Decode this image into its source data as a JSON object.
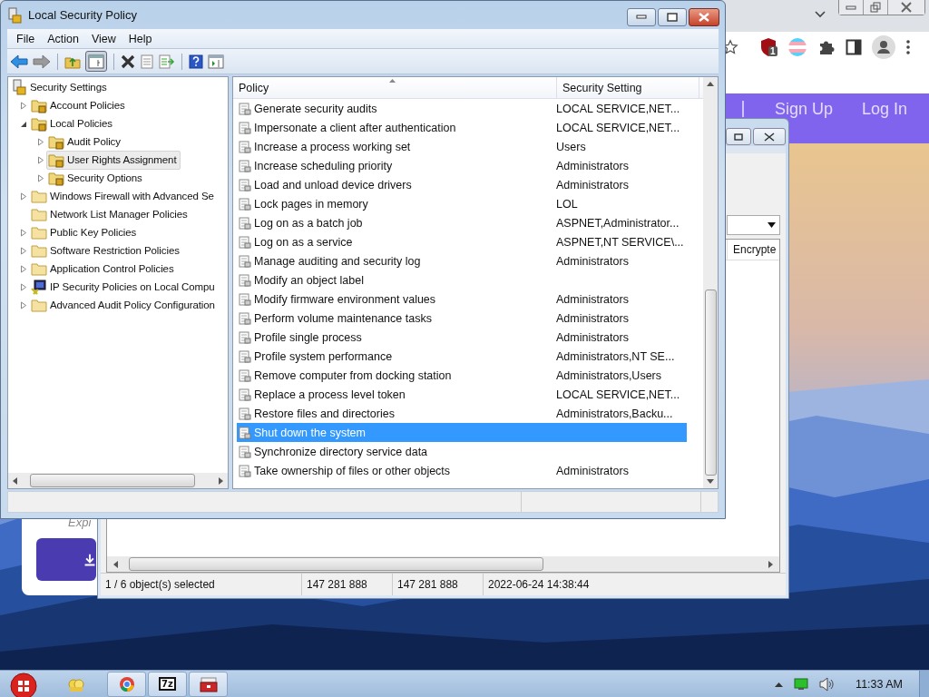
{
  "browser": {
    "extension_badge": "1",
    "nav": [
      "Sign Up",
      "Log In"
    ],
    "card_text": "Expi"
  },
  "zip_window": {
    "column_3": "Encrypte",
    "status": [
      "1 / 6 object(s) selected",
      "147 281 888",
      "147 281 888",
      "2022-06-24 14:38:44"
    ]
  },
  "lsp_window": {
    "title": "Local Security Policy",
    "menu": [
      "File",
      "Action",
      "View",
      "Help"
    ],
    "tree": [
      {
        "label": "Security Settings",
        "kind": "computer",
        "selected": false,
        "children": [
          {
            "label": "Account Policies",
            "kind": "lock-folder",
            "expanded": false,
            "selected": false
          },
          {
            "label": "Local Policies",
            "kind": "lock-folder",
            "expanded": true,
            "selected": false,
            "children": [
              {
                "label": "Audit Policy",
                "kind": "lock-folder",
                "expanded": false,
                "selected": false
              },
              {
                "label": "User Rights Assignment",
                "kind": "lock-folder",
                "expanded": false,
                "selected": true
              },
              {
                "label": "Security Options",
                "kind": "lock-folder",
                "expanded": false,
                "selected": false
              }
            ]
          },
          {
            "label": "Windows Firewall with Advanced Se",
            "kind": "folder",
            "expanded": false,
            "selected": false
          },
          {
            "label": "Network List Manager Policies",
            "kind": "folder",
            "selected": false
          },
          {
            "label": "Public Key Policies",
            "kind": "folder",
            "expanded": false,
            "selected": false
          },
          {
            "label": "Software Restriction Policies",
            "kind": "folder",
            "expanded": false,
            "selected": false
          },
          {
            "label": "Application Control Policies",
            "kind": "folder",
            "expanded": false,
            "selected": false
          },
          {
            "label": "IP Security Policies on Local Compu",
            "kind": "ip-security",
            "expanded": false,
            "selected": false
          },
          {
            "label": "Advanced Audit Policy Configuration",
            "kind": "folder",
            "expanded": false,
            "selected": false
          }
        ]
      }
    ],
    "list": {
      "columns": [
        "Policy",
        "Security Setting"
      ],
      "rows": [
        {
          "policy": "Generate security audits",
          "setting": "LOCAL SERVICE,NET...",
          "selected": false
        },
        {
          "policy": "Impersonate a client after authentication",
          "setting": "LOCAL SERVICE,NET...",
          "selected": false
        },
        {
          "policy": "Increase a process working set",
          "setting": "Users",
          "selected": false
        },
        {
          "policy": "Increase scheduling priority",
          "setting": "Administrators",
          "selected": false
        },
        {
          "policy": "Load and unload device drivers",
          "setting": "Administrators",
          "selected": false
        },
        {
          "policy": "Lock pages in memory",
          "setting": "LOL",
          "selected": false
        },
        {
          "policy": "Log on as a batch job",
          "setting": "ASPNET,Administrator...",
          "selected": false
        },
        {
          "policy": "Log on as a service",
          "setting": "ASPNET,NT SERVICE\\...",
          "selected": false
        },
        {
          "policy": "Manage auditing and security log",
          "setting": "Administrators",
          "selected": false
        },
        {
          "policy": "Modify an object label",
          "selected": false
        },
        {
          "policy": "Modify firmware environment values",
          "setting": "Administrators",
          "selected": false
        },
        {
          "policy": "Perform volume maintenance tasks",
          "setting": "Administrators",
          "selected": false
        },
        {
          "policy": "Profile single process",
          "setting": "Administrators",
          "selected": false
        },
        {
          "policy": "Profile system performance",
          "setting": "Administrators,NT SE...",
          "selected": false
        },
        {
          "policy": "Remove computer from docking station",
          "setting": "Administrators,Users",
          "selected": false
        },
        {
          "policy": "Replace a process level token",
          "setting": "LOCAL SERVICE,NET...",
          "selected": false
        },
        {
          "policy": "Restore files and directories",
          "setting": "Administrators,Backu...",
          "selected": false
        },
        {
          "policy": "Shut down the system",
          "selected": true
        },
        {
          "policy": "Synchronize directory service data",
          "selected": false
        },
        {
          "policy": "Take ownership of files or other objects",
          "setting": "Administrators",
          "selected": false
        }
      ]
    }
  },
  "taskbar": {
    "app_label": "7z",
    "clock": "11:33 AM"
  }
}
